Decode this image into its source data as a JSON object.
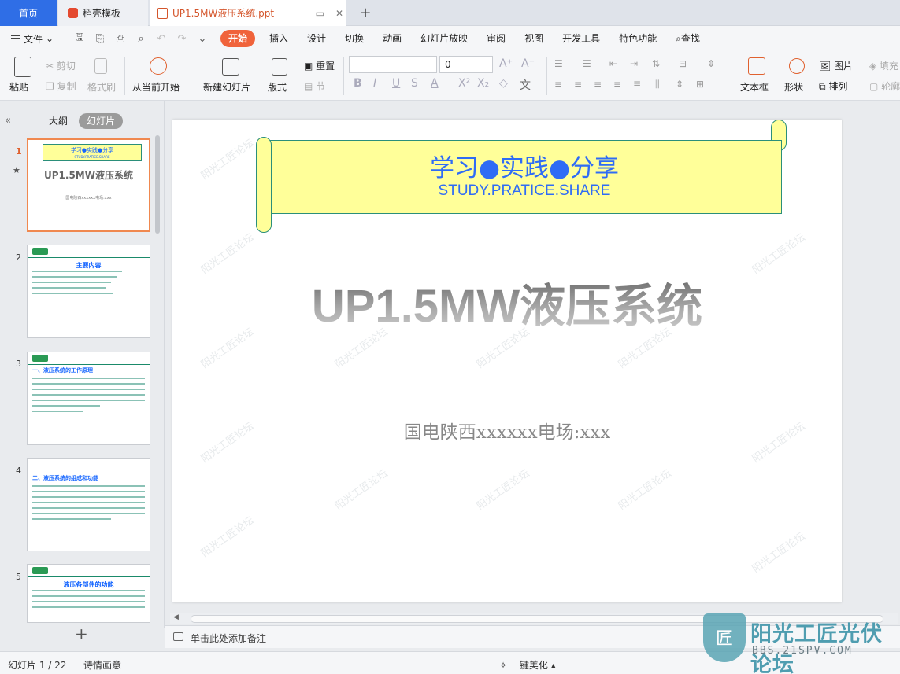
{
  "tabs": {
    "home": "首页",
    "template": "稻壳模板",
    "document": "UP1.5MW液压系统.ppt",
    "add": "+"
  },
  "menu": {
    "file": "文件",
    "items": [
      "开始",
      "插入",
      "设计",
      "切换",
      "动画",
      "幻灯片放映",
      "审阅",
      "视图",
      "开发工具",
      "特色功能"
    ],
    "search": "查找"
  },
  "ribbon": {
    "paste": "粘贴",
    "cut": "剪切",
    "copy": "复制",
    "format_painter": "格式刷",
    "play_from_current": "从当前开始",
    "new_slide": "新建幻灯片",
    "layout": "版式",
    "reset": "重置",
    "section": "节",
    "font_size": "0",
    "textbox": "文本框",
    "shape": "形状",
    "picture": "图片",
    "arrange": "排列",
    "fill": "填充",
    "outline": "轮廓"
  },
  "left_panel": {
    "outline_tab": "大纲",
    "slides_tab": "幻灯片",
    "thumbnails": [
      {
        "num": "1",
        "banner": "学习●实践●分享",
        "banner_sub": "STUDY.PRATICE.SHARE",
        "title": "UP1.5MW液压系统",
        "sub": "国电陕西xxxxxx电场:xxx"
      },
      {
        "num": "2",
        "heading": "主要内容"
      },
      {
        "num": "3",
        "heading": "一、液压系统的工作原理"
      },
      {
        "num": "4",
        "heading": "二、液压系统的组成和功能"
      },
      {
        "num": "5",
        "heading": "液压各部件的功能"
      }
    ]
  },
  "slide": {
    "banner_title": "学习●实践●分享",
    "banner_subtitle": "STUDY.PRATICE.SHARE",
    "title": "UP1.5MW液压系统",
    "subtitle": "国电陕西xxxxxx电场:xxx",
    "watermark": "阳光工匠论坛"
  },
  "notes": {
    "placeholder": "单击此处添加备注"
  },
  "status": {
    "pages": "幻灯片 1 / 22",
    "theme": "诗情画意",
    "beautify": "一键美化"
  },
  "forum": {
    "name": "阳光工匠光伏论坛",
    "url": "BBS.21SPV.COM",
    "badge": "匠"
  },
  "colors": {
    "accent": "#f0633b",
    "home_tab": "#2f6ee6",
    "banner_fill": "#ffff99",
    "banner_text": "#2f6cf5"
  }
}
